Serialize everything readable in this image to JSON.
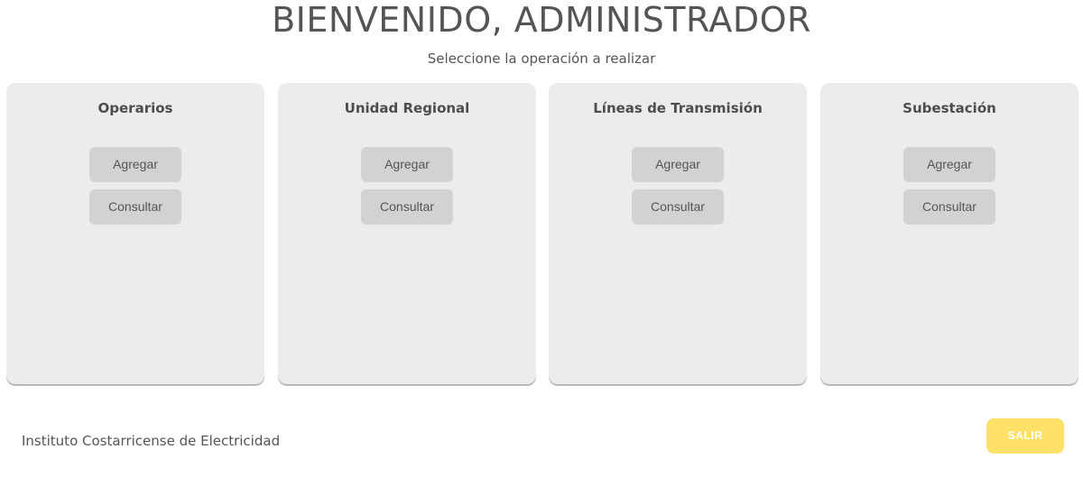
{
  "header": {
    "title": "BIENVENIDO, ADMINISTRADOR",
    "subtitle": "Seleccione la operación a realizar"
  },
  "cards": [
    {
      "title": "Operarios",
      "add_label": "Agregar",
      "query_label": "Consultar"
    },
    {
      "title": "Unidad Regional",
      "add_label": "Agregar",
      "query_label": "Consultar"
    },
    {
      "title": "Líneas de Transmisión",
      "add_label": "Agregar",
      "query_label": "Consultar"
    },
    {
      "title": "Subestación",
      "add_label": "Agregar",
      "query_label": "Consultar"
    }
  ],
  "footer": {
    "organization": "Instituto Costarricense de Electricidad",
    "exit_label": "SALIR"
  },
  "colors": {
    "card_background": "#ebecee",
    "button_background": "#d2d2d2",
    "exit_button": "#fde168",
    "text": "#555555"
  }
}
